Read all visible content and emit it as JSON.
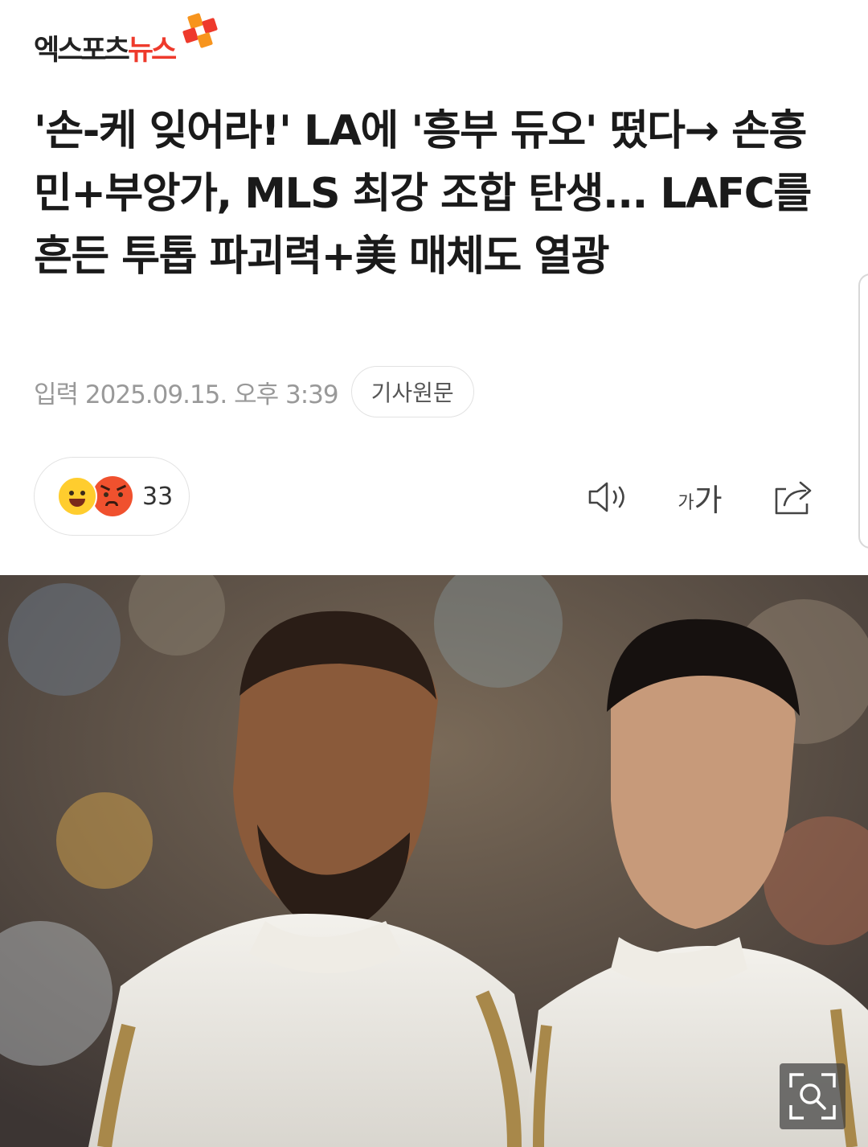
{
  "header": {
    "logo_text_dark": "엑스포츠",
    "logo_text_accent": "뉴스",
    "logo_icon": "brand-squares-icon"
  },
  "article": {
    "title": "'손-케 잊어라!' LA에 '흥부 듀오' 떴다→ 손흥민+부앙가, MLS 최강 조합 탄생... LAFC를 흔든 투톱 파괴력+美 매체도 열광",
    "published": "입력 2025.09.15. 오후 3:39",
    "source_button": "기사원문"
  },
  "reactions": {
    "count": "33",
    "icons": [
      "happy-face-icon",
      "angry-face-icon"
    ]
  },
  "tools": {
    "speaker_icon": "speaker-icon",
    "font_small": "가",
    "font_big": "가",
    "share_icon": "share-icon"
  },
  "photo": {
    "zoom_icon": "zoom-search-icon"
  },
  "colors": {
    "brand_orange": "#f7941d",
    "brand_red": "#ee3a2c",
    "title": "#1a1a1a",
    "meta": "#999999"
  }
}
